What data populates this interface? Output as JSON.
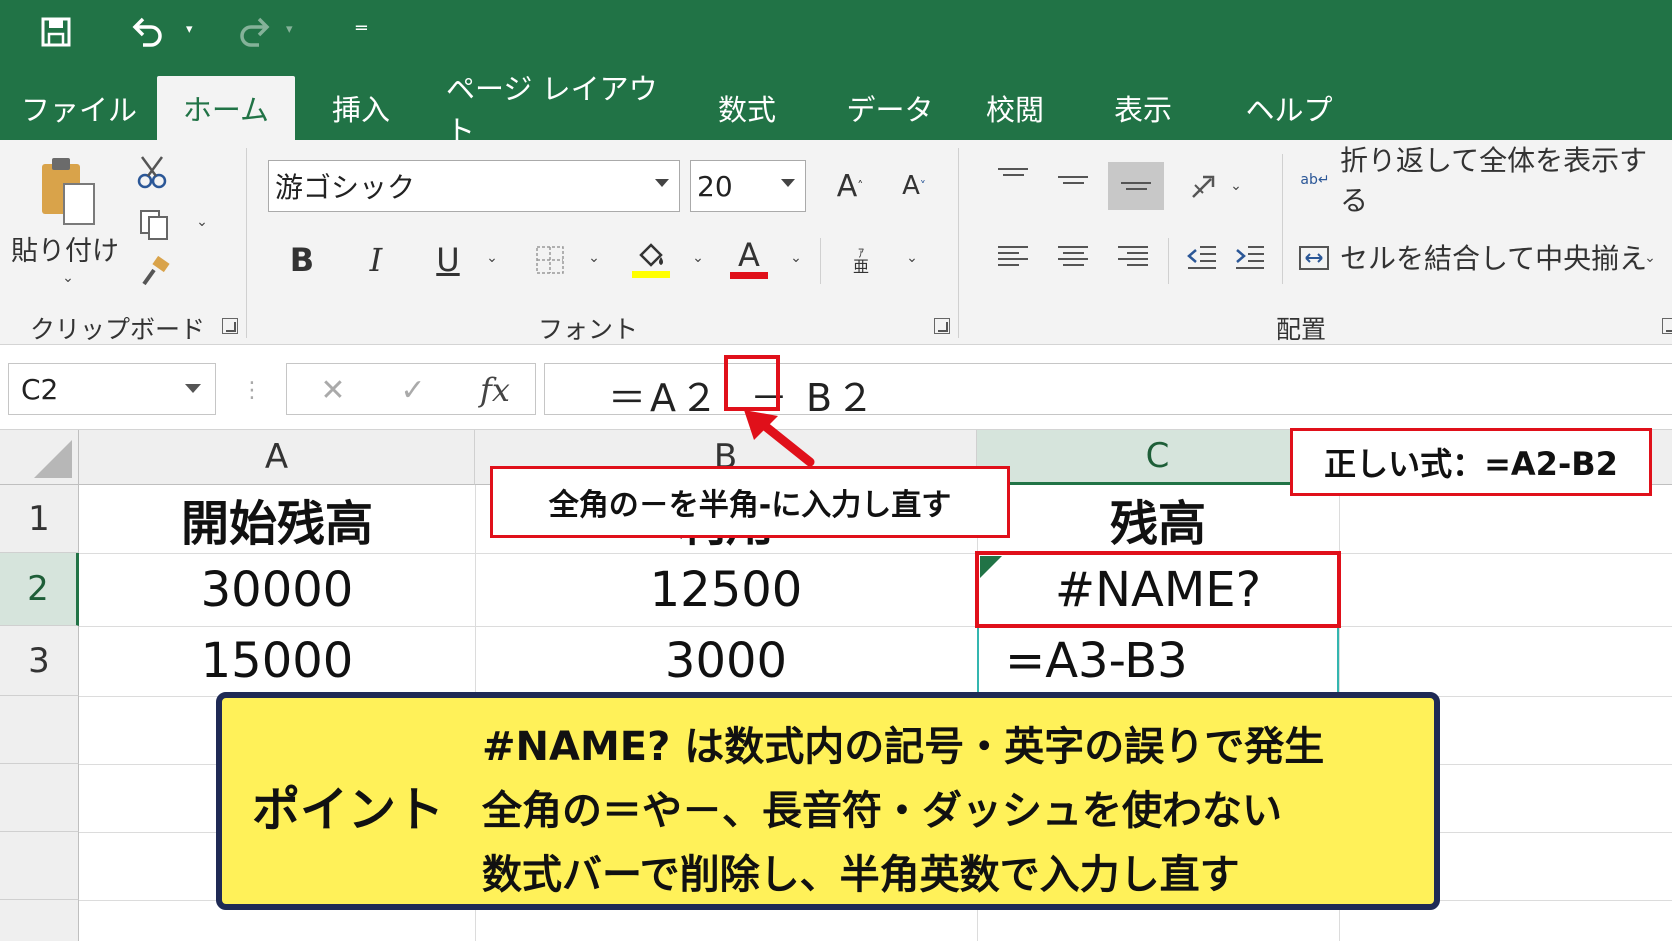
{
  "qat": {
    "save_icon": "save-icon",
    "undo_icon": "undo-icon",
    "redo_icon": "redo-icon",
    "customize_icon": "customize-qat-icon"
  },
  "tabs": [
    {
      "label": "ファイル"
    },
    {
      "label": "ホーム"
    },
    {
      "label": "挿入"
    },
    {
      "label": "ページ レイアウト"
    },
    {
      "label": "数式"
    },
    {
      "label": "データ"
    },
    {
      "label": "校閲"
    },
    {
      "label": "表示"
    },
    {
      "label": "ヘルプ"
    }
  ],
  "ribbon": {
    "clipboard": {
      "paste_label": "貼り付け",
      "group_label": "クリップボード"
    },
    "font": {
      "font_name": "游ゴシック",
      "font_size": "20",
      "bold": "B",
      "italic": "I",
      "underline": "U",
      "font_color_glyph": "A",
      "grow": "A",
      "shrink": "A",
      "group_label": "フォント"
    },
    "alignment": {
      "wrap_text": "折り返して全体を表示する",
      "merge_center": "セルを結合して中央揃え",
      "group_label": "配置"
    },
    "colors": {
      "green": "#217346",
      "highlight": "#ffff00",
      "font_red": "#e0101a"
    }
  },
  "formula_bar": {
    "name_box": "C2",
    "cancel": "✕",
    "enter": "✓",
    "fx": "fx",
    "formula_part1": "＝A２",
    "formula_minus": "－",
    "formula_part2": "B２"
  },
  "grid": {
    "columns": [
      "A",
      "B",
      "C"
    ],
    "rows": [
      "1",
      "2",
      "3"
    ],
    "cells": {
      "A1": "開始残高",
      "B1": "利用",
      "C1": "残高",
      "A2": "30000",
      "B2": "12500",
      "C2": "#NAME?",
      "A3": "15000",
      "B3": "3000",
      "C3": "=A3-B3"
    }
  },
  "annotations": {
    "minus_callout": "全角の－を半角-に入力し直す",
    "correct_formula": "正しい式：=A2-B2",
    "point_title": "ポイント",
    "point_lines": [
      "#NAME? は数式内の記号・英字の誤りで発生",
      "全角の＝や－、長音符・ダッシュを使わない",
      "数式バーで削除し、半角英数で入力し直す"
    ]
  }
}
